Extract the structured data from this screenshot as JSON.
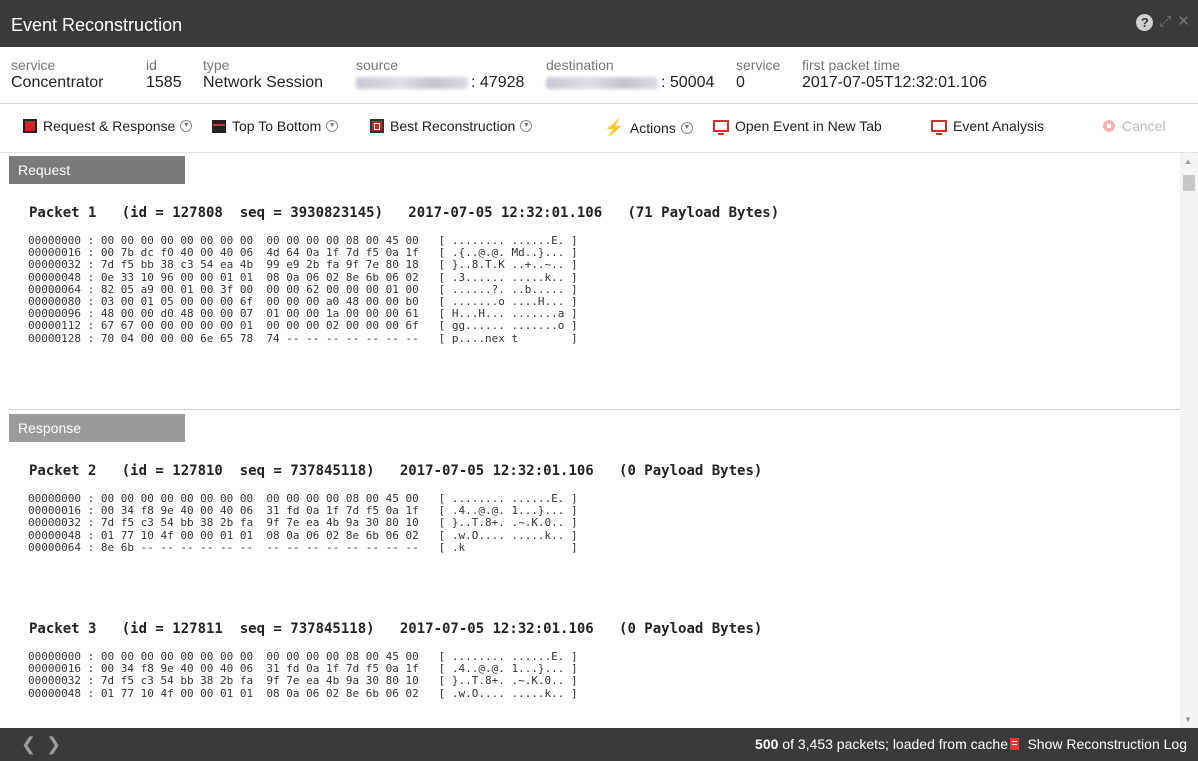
{
  "window": {
    "title": "Event Reconstruction"
  },
  "meta": {
    "service": {
      "label": "service",
      "value": "Concentrator"
    },
    "id": {
      "label": "id",
      "value": "1585"
    },
    "type": {
      "label": "type",
      "value": "Network Session"
    },
    "source": {
      "label": "source",
      "port": ": 47928"
    },
    "destination": {
      "label": "destination",
      "port": ": 50004"
    },
    "service2": {
      "label": "service",
      "value": "0"
    },
    "first_packet_time": {
      "label": "first packet time",
      "value": "2017-07-05T12:32:01.106"
    }
  },
  "toolbar": {
    "request_response": "Request & Response",
    "top_to_bottom": "Top To Bottom",
    "best_reconstruction": "Best Reconstruction",
    "actions": "Actions",
    "open_new_tab": "Open Event in New Tab",
    "event_analysis": "Event Analysis",
    "cancel": "Cancel"
  },
  "sections": {
    "request": "Request",
    "response": "Response"
  },
  "packets": [
    {
      "title": "Packet 1   (id = 127808  seq = 3930823145)   2017-07-05 12:32:01.106   (71 Payload Bytes)",
      "rows": [
        "00000000 : 00 00 00 00 00 00 00 00  00 00 00 00 08 00 45 00   [ ........ ......E. ]",
        "00000016 : 00 7b dc f0 40 00 40 06  4d 64 0a 1f 7d f5 0a 1f   [ .{..@.@. Md..}... ]",
        "00000032 : 7d f5 bb 38 c3 54 ea 4b  99 e9 2b fa 9f 7e 80 18   [ }..8.T.K ..+..~.. ]",
        "00000048 : 0e 33 10 96 00 00 01 01  08 0a 06 02 8e 6b 06 02   [ .3...... .....k.. ]",
        "00000064 : 82 05 a9 00 01 00 3f 00  00 00 62 00 00 00 01 00   [ ......?. ..b..... ]",
        "00000080 : 03 00 01 05 00 00 00 6f  00 00 00 a0 48 00 00 b0   [ .......o ....H... ]",
        "00000096 : 48 00 00 d0 48 00 00 07  01 00 00 1a 00 00 00 61   [ H...H... .......a ]",
        "00000112 : 67 67 00 00 00 00 00 01  00 00 00 02 00 00 00 6f   [ gg...... .......o ]",
        "00000128 : 70 04 00 00 00 6e 65 78  74 -- -- -- -- -- -- --   [ p....nex t        ]"
      ]
    },
    {
      "title": "Packet 2   (id = 127810  seq = 737845118)   2017-07-05 12:32:01.106   (0 Payload Bytes)",
      "rows": [
        "00000000 : 00 00 00 00 00 00 00 00  00 00 00 00 08 00 45 00   [ ........ ......E. ]",
        "00000016 : 00 34 f8 9e 40 00 40 06  31 fd 0a 1f 7d f5 0a 1f   [ .4..@.@. 1...}... ]",
        "00000032 : 7d f5 c3 54 bb 38 2b fa  9f 7e ea 4b 9a 30 80 10   [ }..T.8+. .~.K.0.. ]",
        "00000048 : 01 77 10 4f 00 00 01 01  08 0a 06 02 8e 6b 06 02   [ .w.O.... .....k.. ]",
        "00000064 : 8e 6b -- -- -- -- -- --  -- -- -- -- -- -- -- --   [ .k                ]"
      ]
    },
    {
      "title": "Packet 3   (id = 127811  seq = 737845118)   2017-07-05 12:32:01.106   (0 Payload Bytes)",
      "rows": [
        "00000000 : 00 00 00 00 00 00 00 00  00 00 00 00 08 00 45 00   [ ........ ......E. ]",
        "00000016 : 00 34 f8 9e 40 00 40 06  31 fd 0a 1f 7d f5 0a 1f   [ .4..@.@. 1...}... ]",
        "00000032 : 7d f5 c3 54 bb 38 2b fa  9f 7e ea 4b 9a 30 80 10   [ }..T.8+. .~.K.0.. ]",
        "00000048 : 01 77 10 4f 00 00 01 01  08 0a 06 02 8e 6b 06 02   [ .w.O.... .....k.. ]"
      ]
    }
  ],
  "footer": {
    "loaded_count": "500",
    "status_rest": " of 3,453 packets; loaded from cache",
    "show_log": "Show Reconstruction Log"
  }
}
